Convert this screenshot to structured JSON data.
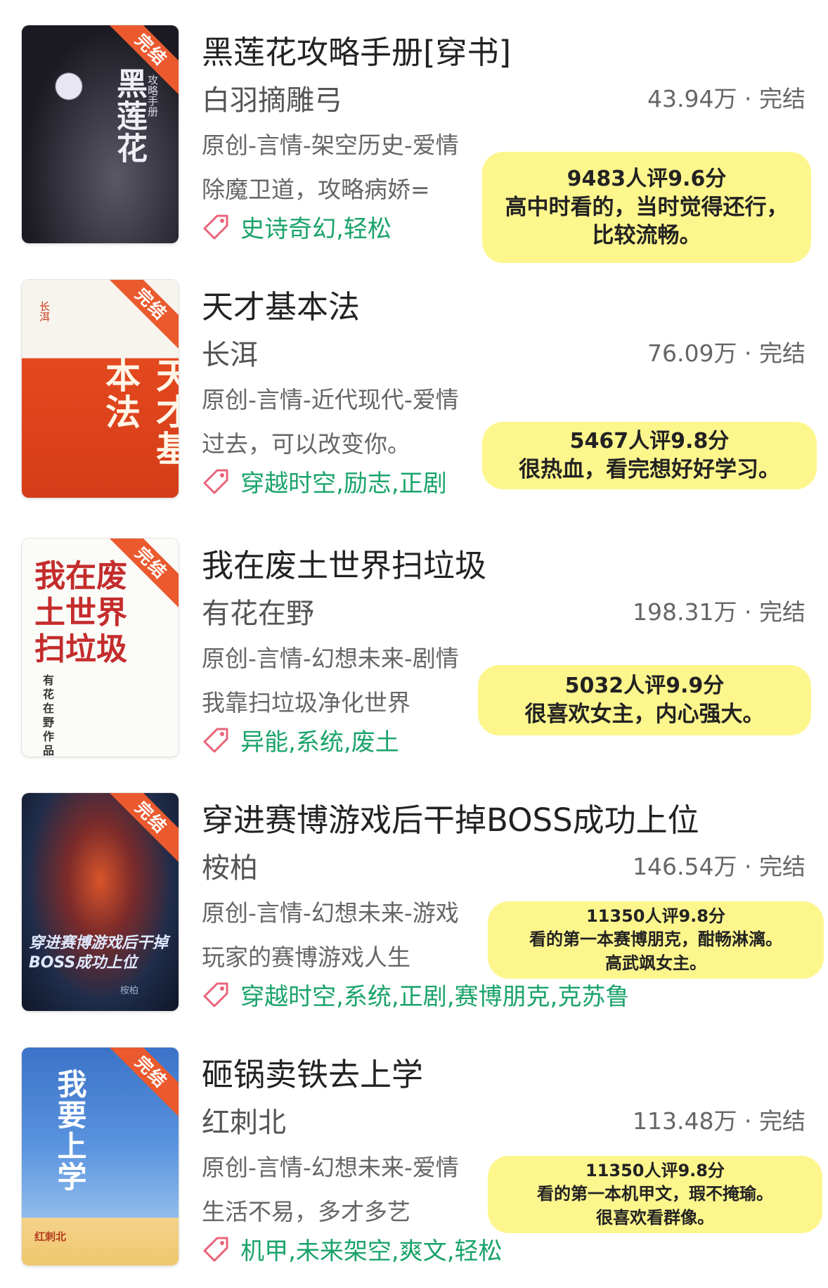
{
  "status_badge": "完结",
  "books": [
    {
      "title": "黑莲花攻略手册[穿书]",
      "author": "白羽摘雕弓",
      "word_count": "43.94万",
      "status": "完结",
      "category": "原创-言情-架空历史-爱情",
      "intro": "除魔卫道，攻略病娇=",
      "tags": "史诗奇幻,轻松",
      "note_score": "9483人评9.6分",
      "note_lines": [
        "高中时看的，当时觉得还行，",
        "比较流畅。"
      ],
      "cover_text": "黑莲花",
      "cover_sub": "攻略手册"
    },
    {
      "title": "天才基本法",
      "author": "长洱",
      "word_count": "76.09万",
      "status": "完结",
      "category": "原创-言情-近代现代-爱情",
      "intro": "过去，可以改变你。",
      "tags": "穿越时空,励志,正剧",
      "note_score": "5467人评9.8分",
      "note_lines": [
        "很热血，看完想好好学习。"
      ],
      "cover_text": "天才基本法",
      "cover_sub": "长洱"
    },
    {
      "title": "我在废土世界扫垃圾",
      "author": "有花在野",
      "word_count": "198.31万",
      "status": "完结",
      "category": "原创-言情-幻想未来-剧情",
      "intro": "我靠扫垃圾净化世界",
      "tags": "异能,系统,废土",
      "note_score": "5032人评9.9分",
      "note_lines": [
        "很喜欢女主，内心强大。"
      ],
      "cover_text": "我在废土世界扫垃圾",
      "cover_sub": "有花在野 作品"
    },
    {
      "title": "穿进赛博游戏后干掉BOSS成功上位",
      "author": "桉柏",
      "word_count": "146.54万",
      "status": "完结",
      "category": "原创-言情-幻想未来-游戏",
      "intro": "玩家的赛博游戏人生",
      "tags": "穿越时空,系统,正剧,赛博朋克,克苏鲁",
      "note_score": "11350人评9.8分",
      "note_lines": [
        "看的第一本赛博朋克，酣畅淋漓。",
        "高武飒女主。"
      ],
      "cover_text": "穿进赛博游戏后干掉BOSS成功上位",
      "cover_sub": "桉柏"
    },
    {
      "title": "砸锅卖铁去上学",
      "author": "红刺北",
      "word_count": "113.48万",
      "status": "完结",
      "category": "原创-言情-幻想未来-爱情",
      "intro": "生活不易，多才多艺",
      "tags": "机甲,未来架空,爽文,轻松",
      "note_score": "11350人评9.8分",
      "note_lines": [
        "看的第一本机甲文，瑕不掩瑜。",
        "很喜欢看群像。"
      ],
      "cover_text": "我要上学",
      "cover_sub": "红刺北"
    }
  ],
  "colors": {
    "tag_green": "#1aa36a",
    "badge_orange": "#ea5a2e",
    "note_yellow": "#fdf68d"
  }
}
